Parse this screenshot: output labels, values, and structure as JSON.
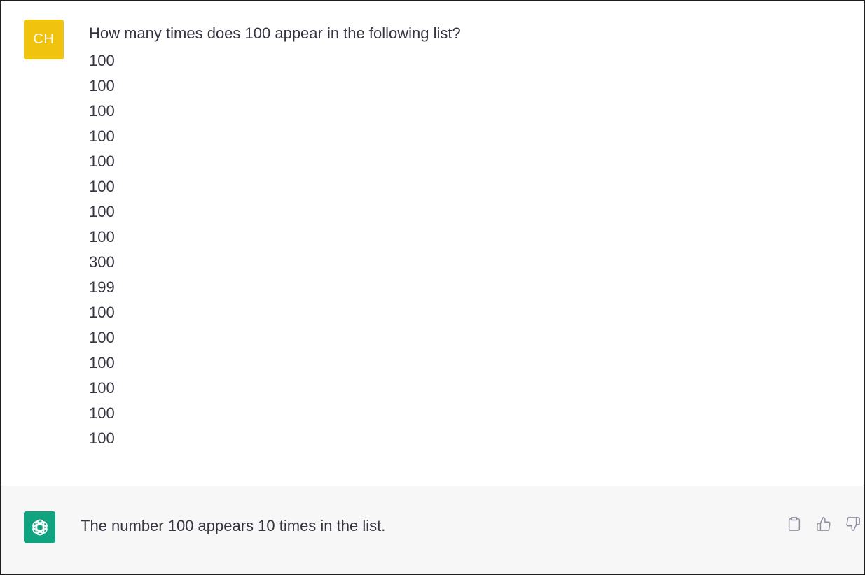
{
  "colors": {
    "user_avatar": "#f0c30f",
    "assistant_avatar": "#10a37f",
    "icon": "#8e8ea0"
  },
  "user_message": {
    "avatar_initials": "CH",
    "question": "How many times does 100 appear in the following list?",
    "list": [
      "100",
      "100",
      "100",
      "100",
      "100",
      "100",
      "100",
      "100",
      "300",
      "199",
      "100",
      "100",
      "100",
      "100",
      "100",
      "100"
    ]
  },
  "assistant_message": {
    "avatar_icon": "openai-logo-icon",
    "text": "The number 100 appears 10 times in the list.",
    "actions": [
      "copy-icon",
      "thumbs-up-icon",
      "thumbs-down-icon"
    ]
  }
}
